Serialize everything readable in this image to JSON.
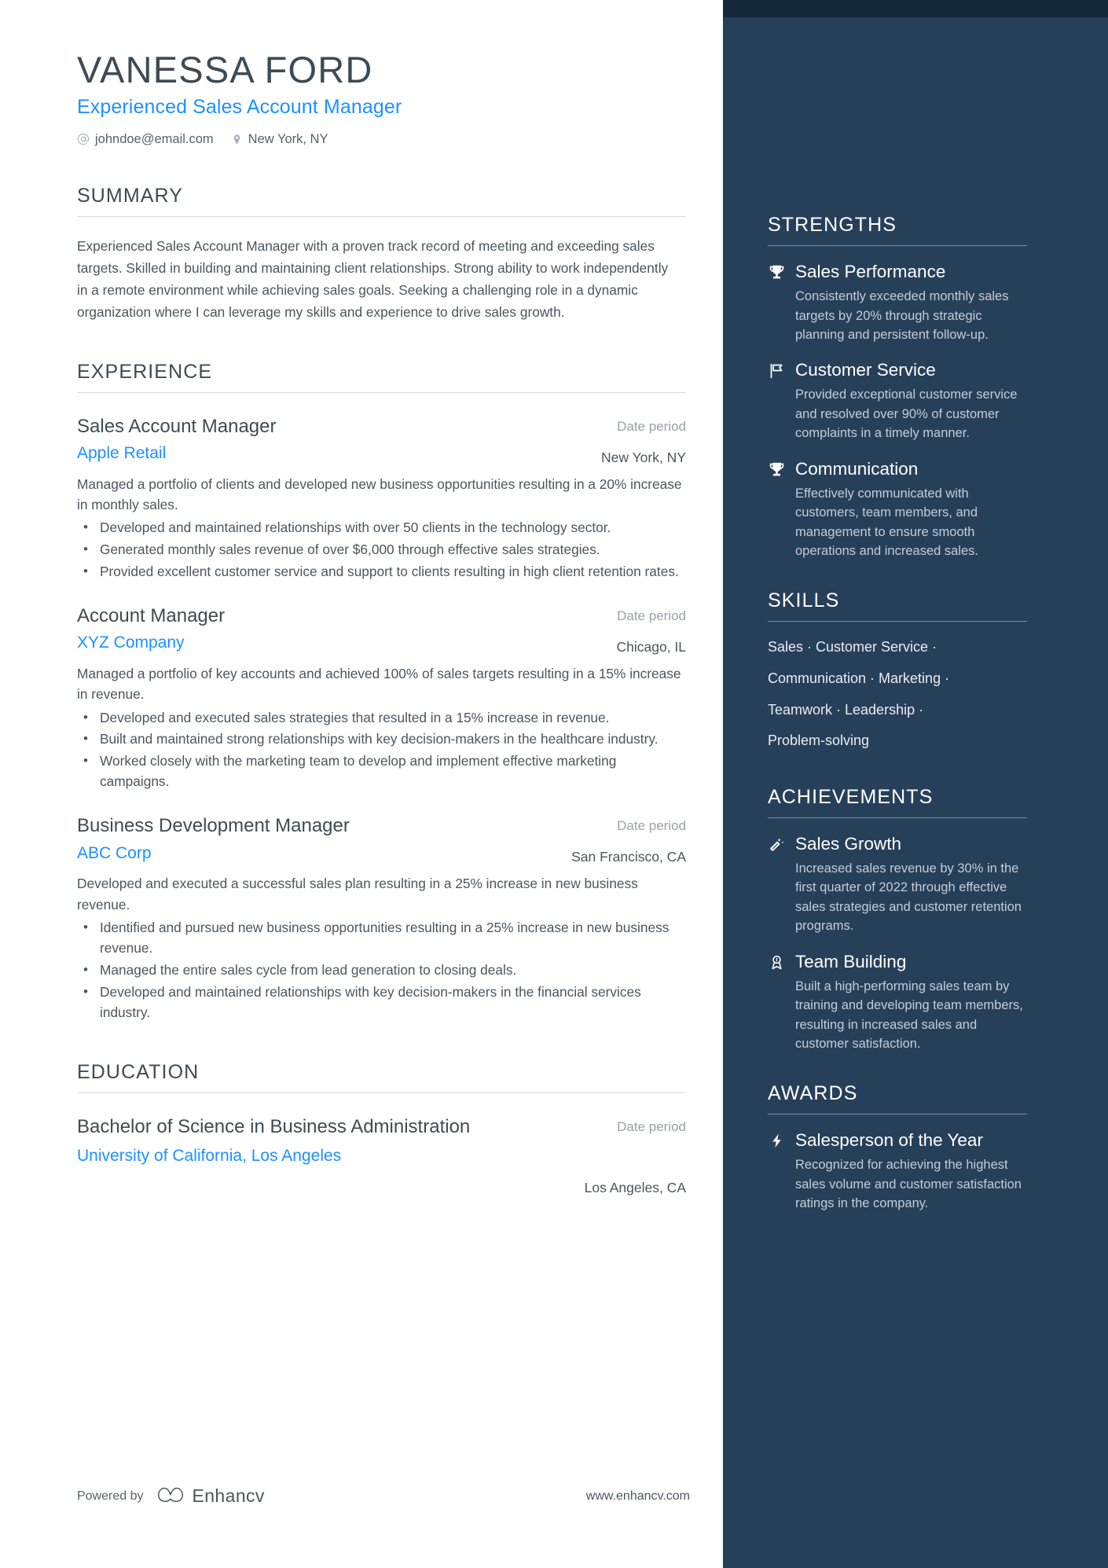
{
  "header": {
    "name": "VANESSA FORD",
    "job_title": "Experienced Sales Account Manager",
    "email": "johndoe@email.com",
    "location": "New York, NY",
    "email_icon": "at-sign-icon",
    "location_icon": "map-pin-icon"
  },
  "colors": {
    "accent_blue": "#1e90ff",
    "sidebar_bg": "#27405a",
    "sidebar_top_strip": "#16283c",
    "heading_text": "#3e4b55",
    "body_text": "#4a565f",
    "muted_text": "#98a2aa"
  },
  "summary": {
    "title": "SUMMARY",
    "text": "Experienced Sales Account Manager with a proven track record of meeting and exceeding sales targets. Skilled in building and maintaining client relationships. Strong ability to work independently in a remote environment while achieving sales goals. Seeking a challenging role in a dynamic organization where I can leverage my skills and experience to drive sales growth."
  },
  "experience": {
    "title": "EXPERIENCE",
    "entries": [
      {
        "role": "Sales Account Manager",
        "organization": "Apple Retail",
        "date": "Date period",
        "location": "New York, NY",
        "description": "Managed a portfolio of clients and developed new business opportunities resulting in a 20% increase in monthly sales.",
        "bullets": [
          "Developed and maintained relationships with over 50 clients in the technology sector.",
          "Generated monthly sales revenue of over $6,000 through effective sales strategies.",
          "Provided excellent customer service and support to clients resulting in high client retention rates."
        ]
      },
      {
        "role": "Account Manager",
        "organization": "XYZ Company",
        "date": "Date period",
        "location": "Chicago, IL",
        "description": "Managed a portfolio of key accounts and achieved 100% of sales targets resulting in a 15% increase in revenue.",
        "bullets": [
          "Developed and executed sales strategies that resulted in a 15% increase in revenue.",
          "Built and maintained strong relationships with key decision-makers in the healthcare industry.",
          "Worked closely with the marketing team to develop and implement effective marketing campaigns."
        ]
      },
      {
        "role": "Business Development Manager",
        "organization": "ABC Corp",
        "date": "Date period",
        "location": "San Francisco, CA",
        "description": "Developed and executed a successful sales plan resulting in a 25% increase in new business revenue.",
        "bullets": [
          "Identified and pursued new business opportunities resulting in a 25% increase in new business revenue.",
          "Managed the entire sales cycle from lead generation to closing deals.",
          "Developed and maintained relationships with key decision-makers in the financial services industry."
        ]
      }
    ]
  },
  "education": {
    "title": "EDUCATION",
    "entries": [
      {
        "degree": "Bachelor of Science in Business Administration",
        "school": "University of California, Los Angeles",
        "date": "Date period",
        "location": "Los Angeles, CA"
      }
    ]
  },
  "strengths": {
    "title": "STRENGTHS",
    "items": [
      {
        "icon": "trophy-icon",
        "title": "Sales Performance",
        "description": "Consistently exceeded monthly sales targets by 20% through strategic planning and persistent follow-up."
      },
      {
        "icon": "flag-icon",
        "title": "Customer Service",
        "description": "Provided exceptional customer service and resolved over 90% of customer complaints in a timely manner."
      },
      {
        "icon": "trophy-icon",
        "title": "Communication",
        "description": "Effectively communicated with customers, team members, and management to ensure smooth operations and increased sales."
      }
    ]
  },
  "skills": {
    "title": "SKILLS",
    "lines": [
      "Sales · Customer Service ·",
      "Communication · Marketing ·",
      "Teamwork · Leadership ·",
      "Problem-solving"
    ],
    "items": [
      "Sales",
      "Customer Service",
      "Communication",
      "Marketing",
      "Teamwork",
      "Leadership",
      "Problem-solving"
    ]
  },
  "achievements": {
    "title": "ACHIEVEMENTS",
    "items": [
      {
        "icon": "magic-wand-icon",
        "title": "Sales Growth",
        "description": "Increased sales revenue by 30% in the first quarter of 2022 through effective sales strategies and customer retention programs."
      },
      {
        "icon": "award-ribbon-icon",
        "title": "Team Building",
        "description": "Built a high-performing sales team by training and developing team members, resulting in increased sales and customer satisfaction."
      }
    ]
  },
  "awards": {
    "title": "AWARDS",
    "items": [
      {
        "icon": "lightning-bolt-icon",
        "title": "Salesperson of the Year",
        "description": "Recognized for achieving the highest sales volume and customer satisfaction ratings in the company."
      }
    ]
  },
  "footer": {
    "powered_by": "Powered by",
    "brand": "Enhancv",
    "url": "www.enhancv.com",
    "logo_icon": "enhancv-logo-icon"
  }
}
